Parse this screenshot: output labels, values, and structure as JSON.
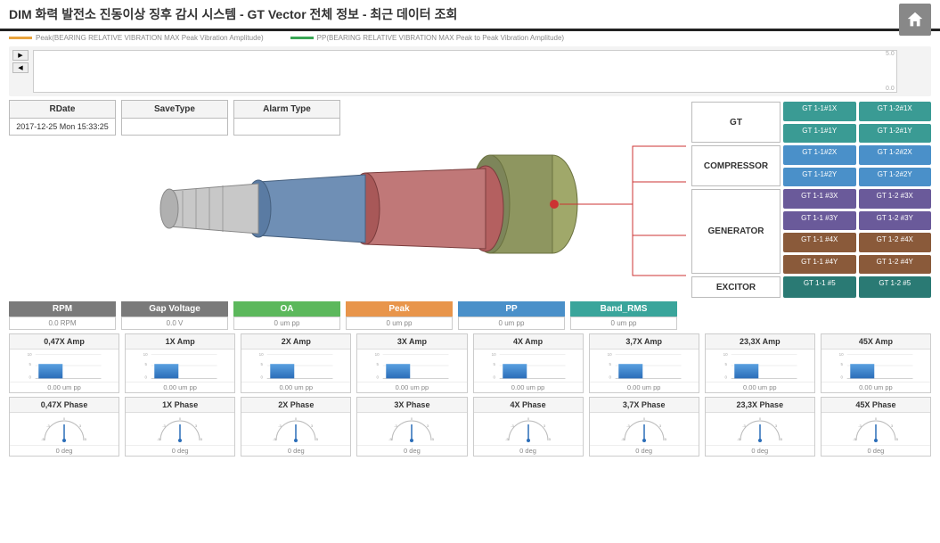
{
  "title": "DIM  화력 발전소 진동이상 징후 감시 시스템 - GT Vector 전체 정보 - 최근 데이터 조회",
  "legend": {
    "peak": "Peak(BEARING RELATIVE VIBRATION MAX Peak Vibration Amplitude)",
    "pp": "PP(BEARING RELATIVE VIBRATION MAX Peak to Peak Vibration Amplitude)"
  },
  "chart": {
    "ymax": "5.0",
    "ymin": "0.0"
  },
  "info": {
    "headers": {
      "rdate": "RDate",
      "savetype": "SaveType",
      "alarmtype": "Alarm Type"
    },
    "values": {
      "rdate": "2017-12-25 Mon 15:33:25",
      "savetype": "",
      "alarmtype": ""
    }
  },
  "side": {
    "rows": [
      {
        "label": "GT",
        "chips": [
          [
            "GT 1-1#1X",
            "GT 1-2#1X"
          ],
          [
            "GT 1-1#1Y",
            "GT 1-2#1Y"
          ]
        ],
        "cls": "teal"
      },
      {
        "label": "COMPRESSOR",
        "chips": [
          [
            "GT 1-1#2X",
            "GT 1-2#2X"
          ],
          [
            "GT 1-1#2Y",
            "GT 1-2#2Y"
          ]
        ],
        "cls": "blue"
      },
      {
        "label": "GENERATOR",
        "chips": [
          [
            "GT 1-1 #3X",
            "GT 1-2 #3X"
          ],
          [
            "GT 1-1 #3Y",
            "GT 1-2 #3Y"
          ],
          [
            "GT 1-1 #4X",
            "GT 1-2 #4X"
          ],
          [
            "GT 1-1 #4Y",
            "GT 1-2 #4Y"
          ]
        ],
        "cls": "mixed"
      },
      {
        "label": "EXCITOR",
        "chips": [
          [
            "GT 1-1 #5",
            "GT 1-2 #5"
          ]
        ],
        "cls": "dteal"
      }
    ]
  },
  "metrics": [
    {
      "name": "RPM",
      "value": "0.0 RPM",
      "cls": "m-gray"
    },
    {
      "name": "Gap Voltage",
      "value": "0.0 V",
      "cls": "m-gray"
    },
    {
      "name": "OA",
      "value": "0 um pp",
      "cls": "m-green"
    },
    {
      "name": "Peak",
      "value": "0 um pp",
      "cls": "m-orange"
    },
    {
      "name": "PP",
      "value": "0 um pp",
      "cls": "m-blue"
    },
    {
      "name": "Band_RMS",
      "value": "0 um pp",
      "cls": "m-teal"
    }
  ],
  "amps": [
    {
      "title": "0,47X Amp",
      "foot": "0.00 um pp"
    },
    {
      "title": "1X Amp",
      "foot": "0.00 um pp"
    },
    {
      "title": "2X Amp",
      "foot": "0.00 um pp"
    },
    {
      "title": "3X Amp",
      "foot": "0.00 um pp"
    },
    {
      "title": "4X Amp",
      "foot": "0.00 um pp"
    },
    {
      "title": "3,7X Amp",
      "foot": "0.00 um pp"
    },
    {
      "title": "23,3X Amp",
      "foot": "0.00 um pp"
    },
    {
      "title": "45X Amp",
      "foot": "0.00 um pp"
    }
  ],
  "phases": [
    {
      "title": "0,47X Phase",
      "foot": "0 deg"
    },
    {
      "title": "1X Phase",
      "foot": "0 deg"
    },
    {
      "title": "2X Phase",
      "foot": "0 deg"
    },
    {
      "title": "3X Phase",
      "foot": "0 deg"
    },
    {
      "title": "4X Phase",
      "foot": "0 deg"
    },
    {
      "title": "3,7X Phase",
      "foot": "0 deg"
    },
    {
      "title": "23,3X Phase",
      "foot": "0 deg"
    },
    {
      "title": "45X Phase",
      "foot": "0 deg"
    }
  ],
  "chart_data": {
    "type": "line",
    "series": [
      {
        "name": "Peak",
        "values": []
      },
      {
        "name": "PP",
        "values": []
      }
    ],
    "ylim": [
      0,
      5
    ]
  }
}
